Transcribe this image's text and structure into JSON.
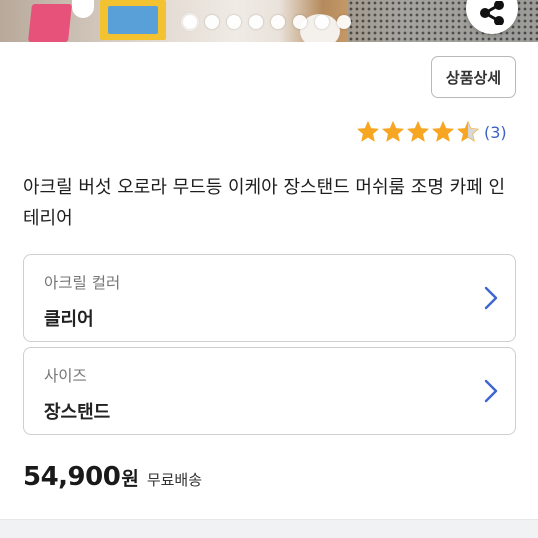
{
  "carousel": {
    "total_slides": 8,
    "active_index": 0
  },
  "share": {
    "icon": "share-icon"
  },
  "detail_button": {
    "label": "상품상세"
  },
  "rating": {
    "value": 4.5,
    "max": 5,
    "count_text": "(3)",
    "star_color": "#f6a623",
    "empty_color": "#d8d8d8"
  },
  "product": {
    "title": "아크릴 버섯 오로라 무드등 이케아 장스탠드 머쉬룸 조명 카페 인테리어"
  },
  "options": [
    {
      "label": "아크릴 컬러",
      "value": "클리어",
      "icon": "chevron-right-icon"
    },
    {
      "label": "사이즈",
      "value": "장스탠드",
      "icon": "chevron-right-icon"
    }
  ],
  "price": {
    "amount": "54,900",
    "currency": "원",
    "shipping": "무료배송"
  },
  "colors": {
    "link_blue": "#3b62c4",
    "chevron_blue": "#3d66d0"
  }
}
